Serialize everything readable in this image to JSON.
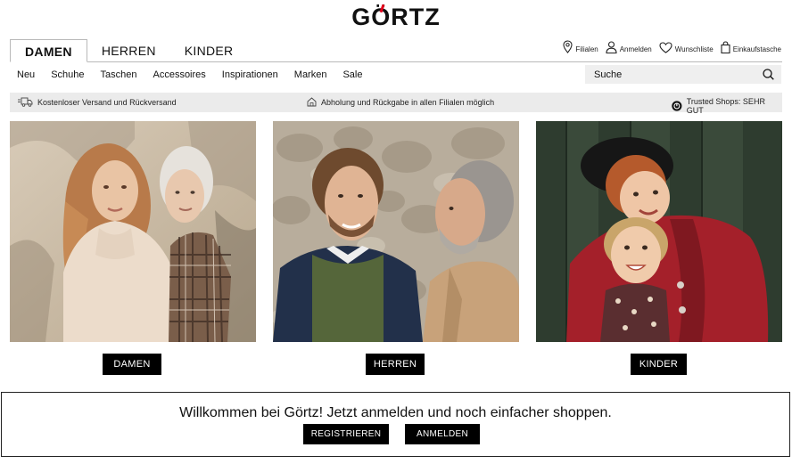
{
  "logo": {
    "text": "GÖRTZ"
  },
  "gender_tabs": [
    {
      "label": "DAMEN",
      "active": true
    },
    {
      "label": "HERREN",
      "active": false
    },
    {
      "label": "KINDER",
      "active": false
    }
  ],
  "service_nav": {
    "stores": "Filialen",
    "login": "Anmelden",
    "wishlist": "Wunschliste",
    "cart": "Einkaufstasche"
  },
  "categories": [
    "Neu",
    "Schuhe",
    "Taschen",
    "Accessoires",
    "Inspirationen",
    "Marken",
    "Sale"
  ],
  "search": {
    "placeholder": "Suche",
    "icon": "search-icon"
  },
  "info_bar": {
    "shipping": "Kostenloser Versand und Rückversand",
    "pickup": "Abholung und Rückgabe in allen Filialen möglich",
    "trusted": "Trusted Shops: SEHR GUT"
  },
  "tiles": [
    {
      "button": "DAMEN"
    },
    {
      "button": "HERREN"
    },
    {
      "button": "KINDER"
    }
  ],
  "welcome": {
    "text": "Willkommen bei Görtz! Jetzt anmelden und noch einfacher shoppen.",
    "register": "REGISTRIEREN",
    "login": "ANMELDEN"
  },
  "colors": {
    "accent_red": "#e3001b",
    "black": "#000000",
    "info_bg": "#ebebeb"
  }
}
